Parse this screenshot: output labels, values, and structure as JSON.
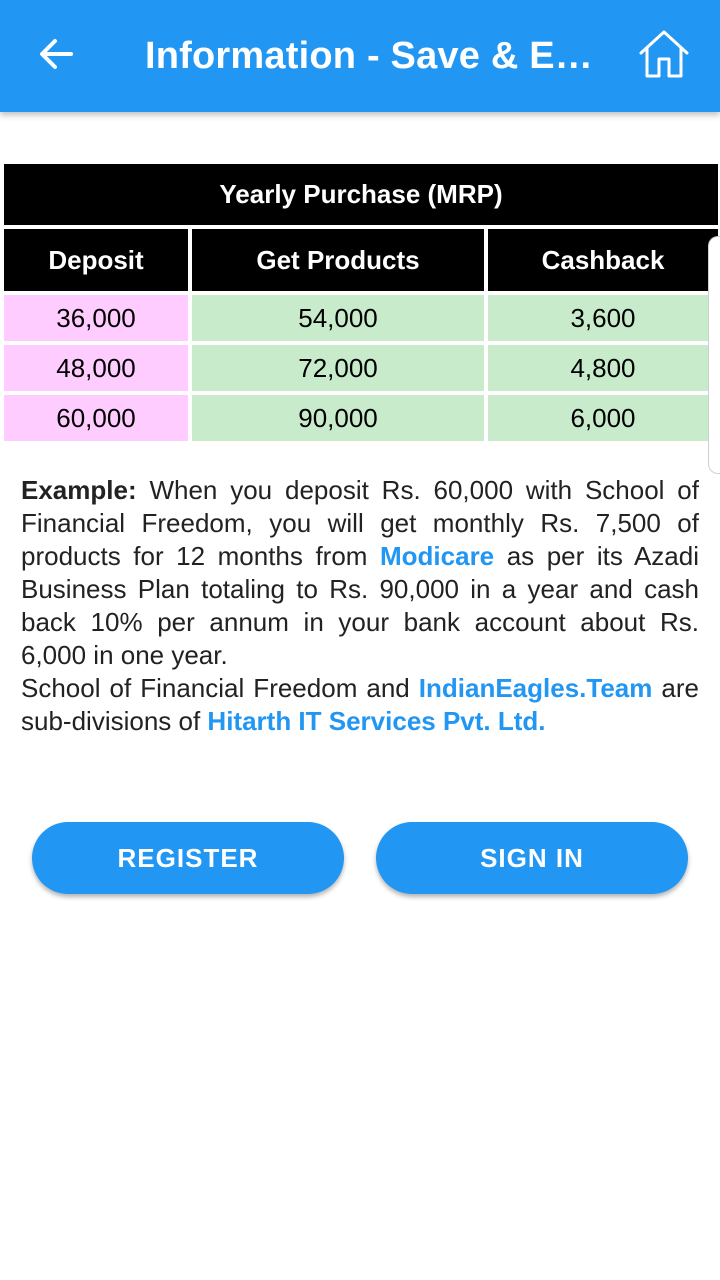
{
  "appbar": {
    "title": "Information - Save & E…",
    "back_icon": "arrow-left-icon",
    "home_icon": "home-icon",
    "color": "#2196F3"
  },
  "table": {
    "title": "Yearly Purchase (MRP)",
    "headers": [
      "Deposit",
      "Get Products",
      "Cashback"
    ],
    "rows": [
      [
        "36,000",
        "54,000",
        "3,600"
      ],
      [
        "48,000",
        "72,000",
        "4,800"
      ],
      [
        "60,000",
        "90,000",
        "6,000"
      ]
    ],
    "colors": {
      "deposit_bg": "#FFCCFF",
      "other_bg": "#C8EBCB"
    }
  },
  "example": {
    "label": "Example:",
    "text1": " When you deposit Rs. 60,000 with School of Financial Freedom, you will get monthly Rs. 7,500 of products for 12 months from ",
    "link1": "Modicare",
    "text2": " as per its Azadi Business Plan totaling to Rs. 90,000 in a year and cash back 10% per annum in your bank account about Rs. 6,000 in one year.",
    "text3": "School of Financial Freedom and ",
    "link2": "IndianEagles.Team",
    "text4": " are sub-divisions of ",
    "link3": "Hitarth IT Services Pvt. Ltd."
  },
  "buttons": {
    "register": "REGISTER",
    "signin": "SIGN IN"
  }
}
